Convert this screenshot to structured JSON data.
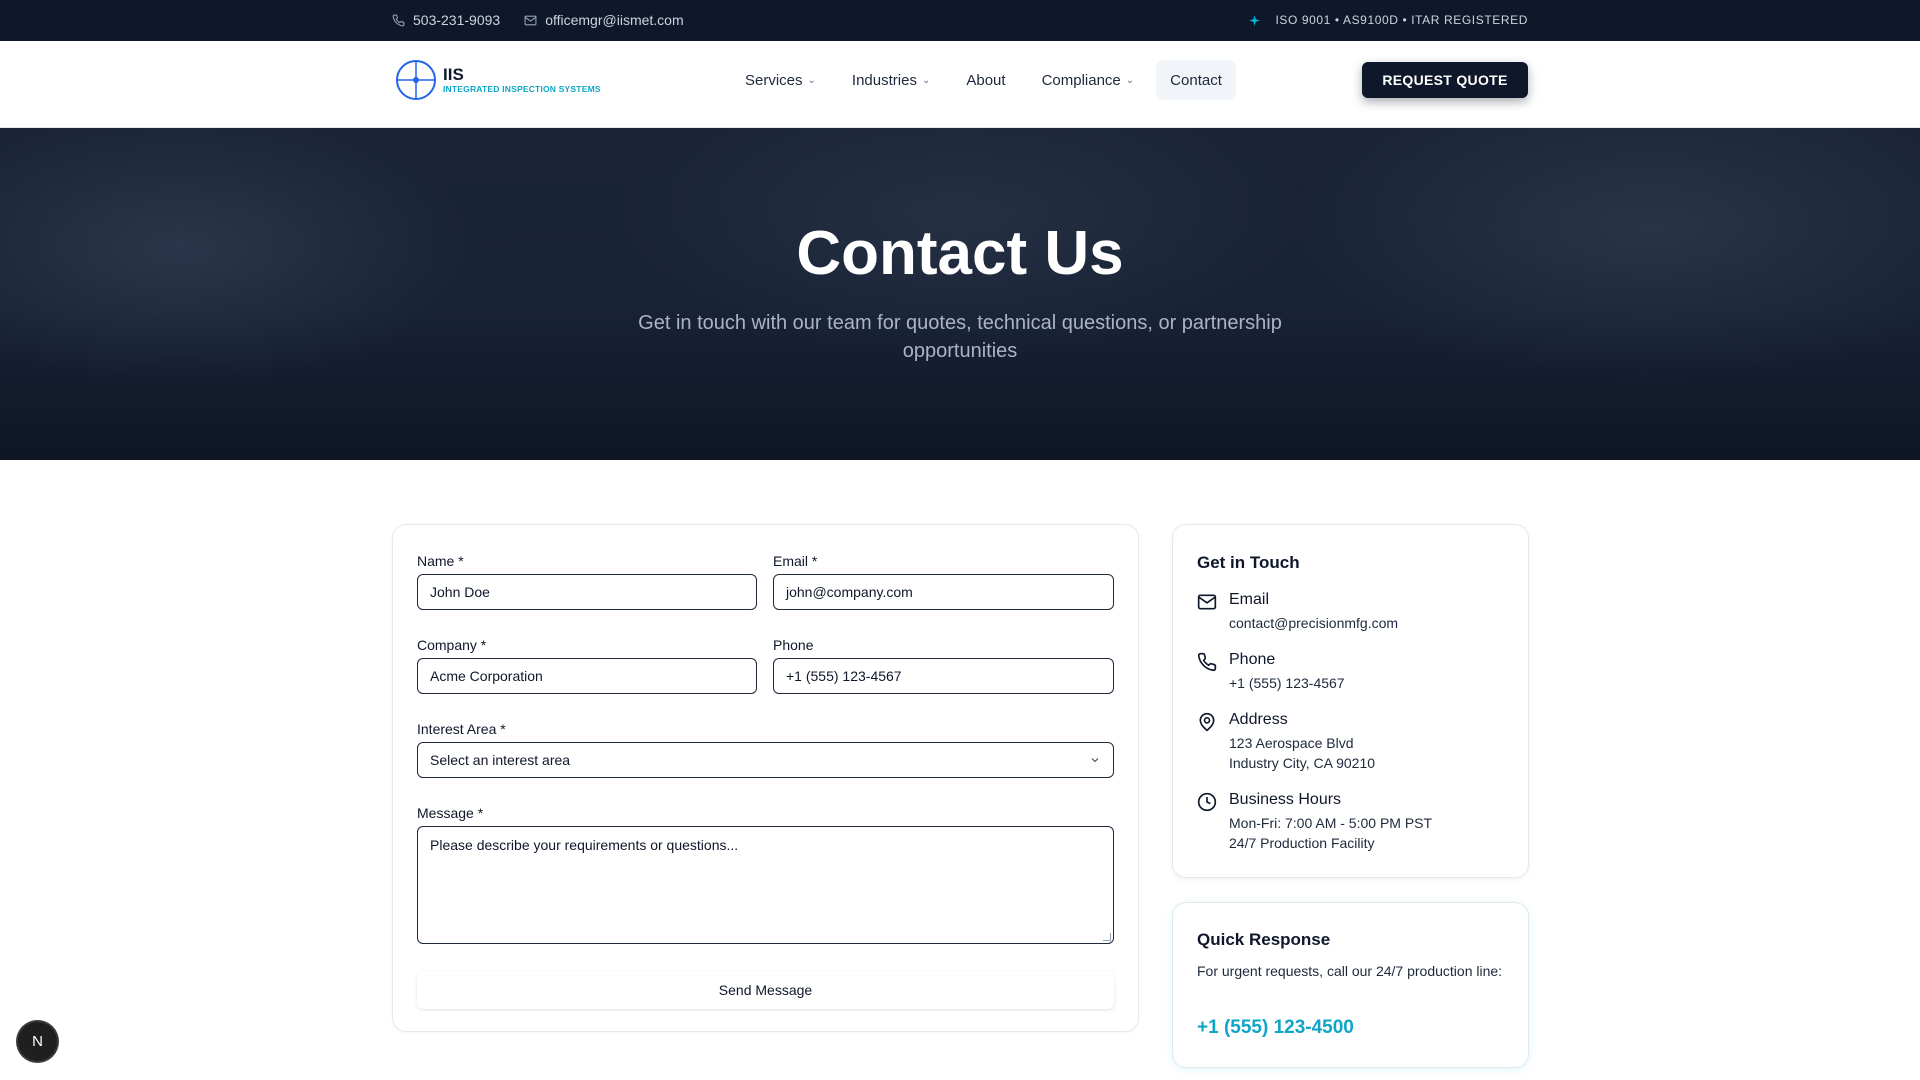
{
  "topbar": {
    "phone": "503-231-9093",
    "email": "officemgr@iismet.com",
    "certs": "ISO 9001 • AS9100D • ITAR REGISTERED"
  },
  "brand": {
    "name": "IIS",
    "tagline": "INTEGRATED INSPECTION SYSTEMS"
  },
  "nav": {
    "items": [
      {
        "label": "Services",
        "dropdown": true
      },
      {
        "label": "Industries",
        "dropdown": true
      },
      {
        "label": "About",
        "dropdown": false
      },
      {
        "label": "Compliance",
        "dropdown": true
      },
      {
        "label": "Contact",
        "dropdown": false,
        "active": true
      }
    ],
    "cta": "REQUEST QUOTE"
  },
  "hero": {
    "title": "Contact Us",
    "subtitle": "Get in touch with our team for quotes, technical questions, or partnership opportunities"
  },
  "form": {
    "name_label": "Name *",
    "name_placeholder": "John Doe",
    "email_label": "Email *",
    "email_placeholder": "john@company.com",
    "company_label": "Company *",
    "company_placeholder": "Acme Corporation",
    "phone_label": "Phone",
    "phone_placeholder": "+1 (555) 123-4567",
    "interest_label": "Interest Area *",
    "interest_value": "Select an interest area",
    "message_label": "Message *",
    "message_placeholder": "Please describe your requirements or questions...",
    "submit": "Send Message"
  },
  "contact_info": {
    "title": "Get in Touch",
    "email_title": "Email",
    "email_value": "contact@precisionmfg.com",
    "phone_title": "Phone",
    "phone_value": "+1 (555) 123-4567",
    "address_title": "Address",
    "address_line1": "123 Aerospace Blvd",
    "address_line2": "Industry City, CA 90210",
    "hours_title": "Business Hours",
    "hours_line1": "Mon-Fri: 7:00 AM - 5:00 PM PST",
    "hours_line2": "24/7 Production Facility"
  },
  "quick_response": {
    "title": "Quick Response",
    "text": "For urgent requests, call our 24/7 production line:",
    "number": "+1 (555) 123-4500"
  },
  "badge": "N",
  "colors": {
    "navy": "#0f172a",
    "accent": "#0ea5c6"
  }
}
